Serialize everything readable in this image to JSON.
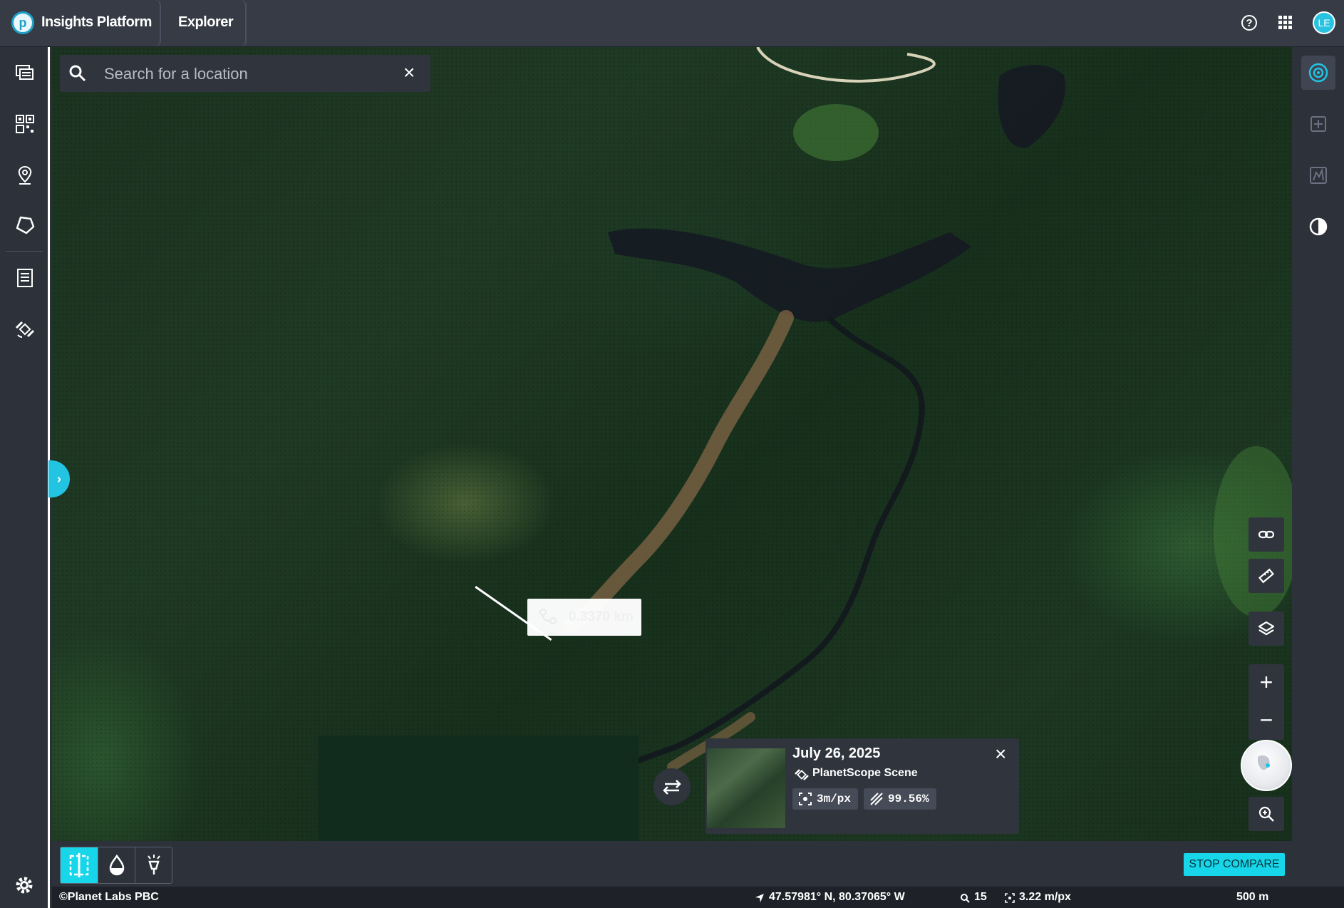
{
  "header": {
    "logo_letter": "p",
    "app_name": "Insights Platform",
    "tab": "Explorer",
    "avatar_initials": "LE"
  },
  "left_sidebar": {
    "items": [
      "feed-icon",
      "grid-qr-icon",
      "location-pin-icon",
      "polygon-icon",
      "document-list-icon",
      "satellite-icon"
    ],
    "settings": "gear-icon"
  },
  "search": {
    "placeholder": "Search for a location",
    "value": ""
  },
  "right_panel": {
    "items": [
      "radar-icon",
      "add-image-icon",
      "chart-frame-icon",
      "contrast-icon"
    ],
    "active": "radar-icon",
    "accent": "#23c3e2"
  },
  "map_controls": [
    "link-icon",
    "ruler-icon",
    "layers-icon",
    "zoom-in-plus-icon",
    "zoom-out-minus-icon",
    "globe-minimap",
    "zoom-search-icon"
  ],
  "measurement": {
    "distance": "0.3370 km"
  },
  "scene": {
    "date": "July 26, 2025",
    "type": "PlanetScope Scene",
    "resolution": "3m/px",
    "coverage": "99.56%"
  },
  "compare": {
    "stop_label": "STOP COMPARE",
    "accent": "#17d6ea"
  },
  "footer": {
    "copyright": "©Planet Labs PBC",
    "coordinates": "47.57981° N, 80.37065° W",
    "zoom": "15",
    "scale": "3.22 m/px",
    "scale_bar": "500 m"
  }
}
